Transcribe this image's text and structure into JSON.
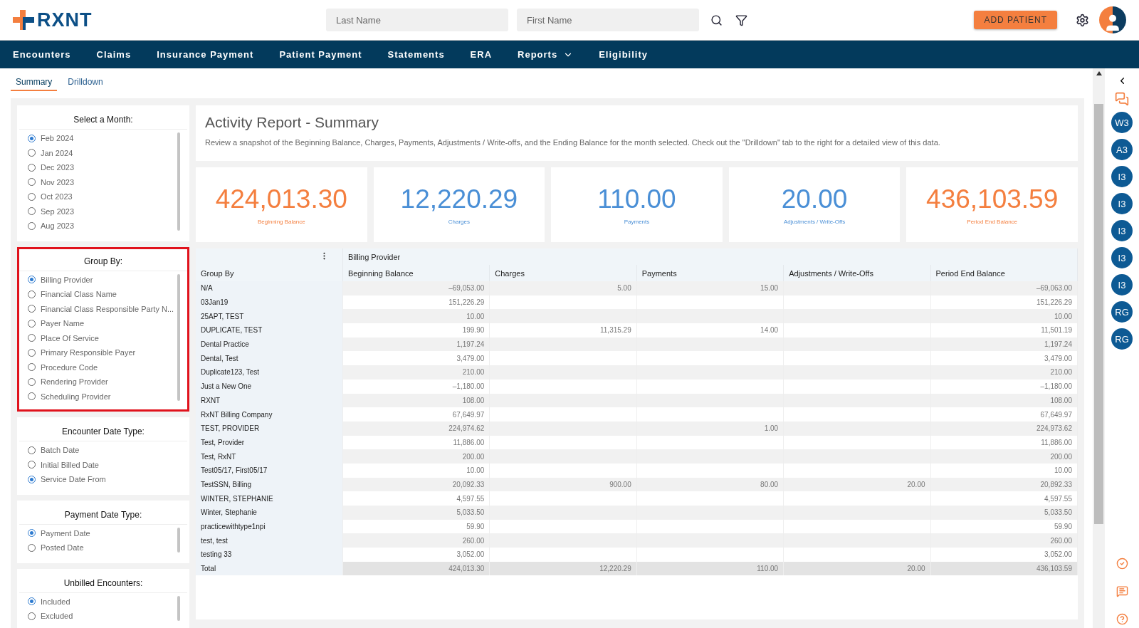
{
  "header": {
    "logo": "RXNT",
    "search_fields": [
      {
        "placeholder": "Last Name"
      },
      {
        "placeholder": "First Name"
      }
    ],
    "add_button": "ADD PATIENT"
  },
  "nav": [
    {
      "label": "Encounters",
      "dropdown": false
    },
    {
      "label": "Claims",
      "dropdown": false
    },
    {
      "label": "Insurance Payment",
      "dropdown": false
    },
    {
      "label": "Patient Payment",
      "dropdown": false
    },
    {
      "label": "Statements",
      "dropdown": false
    },
    {
      "label": "ERA",
      "dropdown": false
    },
    {
      "label": "Reports",
      "dropdown": true
    },
    {
      "label": "Eligibility",
      "dropdown": false
    }
  ],
  "tabs": [
    {
      "label": "Summary",
      "selected": true
    },
    {
      "label": "Drilldown",
      "selected": false
    }
  ],
  "filters": [
    {
      "title": "Select a Month:",
      "highlighted": false,
      "options": [
        {
          "label": "Feb 2024",
          "selected": true
        },
        {
          "label": "Jan 2024",
          "selected": false
        },
        {
          "label": "Dec 2023",
          "selected": false
        },
        {
          "label": "Nov 2023",
          "selected": false
        },
        {
          "label": "Oct 2023",
          "selected": false
        },
        {
          "label": "Sep 2023",
          "selected": false
        },
        {
          "label": "Aug 2023",
          "selected": false
        }
      ]
    },
    {
      "title": "Group By:",
      "highlighted": true,
      "options": [
        {
          "label": "Billing Provider",
          "selected": true
        },
        {
          "label": "Financial Class Name",
          "selected": false
        },
        {
          "label": "Financial Class Responsible Party N...",
          "selected": false
        },
        {
          "label": "Payer Name",
          "selected": false
        },
        {
          "label": "Place Of Service",
          "selected": false
        },
        {
          "label": "Primary Responsible Payer",
          "selected": false
        },
        {
          "label": "Procedure Code",
          "selected": false
        },
        {
          "label": "Rendering Provider",
          "selected": false
        },
        {
          "label": "Scheduling Provider",
          "selected": false
        }
      ]
    },
    {
      "title": "Encounter Date Type:",
      "highlighted": false,
      "options": [
        {
          "label": "Batch Date",
          "selected": false
        },
        {
          "label": "Initial Billed Date",
          "selected": false
        },
        {
          "label": "Service Date From",
          "selected": true
        }
      ]
    },
    {
      "title": "Payment Date Type:",
      "highlighted": false,
      "options": [
        {
          "label": "Payment Date",
          "selected": true
        },
        {
          "label": "Posted Date",
          "selected": false
        }
      ]
    },
    {
      "title": "Unbilled Encounters:",
      "highlighted": false,
      "options": [
        {
          "label": "Included",
          "selected": true
        },
        {
          "label": "Excluded",
          "selected": false
        }
      ]
    }
  ],
  "report": {
    "title": "Activity Report - Summary",
    "description": "Review a snapshot of the Beginning Balance, Charges, Payments, Adjustments / Write-offs, and the Ending Balance for the month selected. Check out the \"Drilldown\" tab to the right for a detailed view of this data."
  },
  "stats": [
    {
      "value": "424,013.30",
      "label": "Beginning Balance",
      "color": "#f47f3f"
    },
    {
      "value": "12,220.29",
      "label": "Charges",
      "color": "#4a8fd6"
    },
    {
      "value": "110.00",
      "label": "Payments",
      "color": "#4a8fd6"
    },
    {
      "value": "20.00",
      "label": "Adjustments / Write-Offs",
      "color": "#4a8fd6"
    },
    {
      "value": "436,103.59",
      "label": "Period End Balance",
      "color": "#f47f3f"
    }
  ],
  "table": {
    "group_header": "Billing Provider",
    "columns": [
      "Group By",
      "Beginning Balance",
      "Charges",
      "Payments",
      "Adjustments / Write-Offs",
      "Period End Balance"
    ],
    "rows": [
      [
        "N/A",
        "–69,053.00",
        "5.00",
        "15.00",
        null,
        "–69,063.00"
      ],
      [
        "03Jan19",
        "151,226.29",
        null,
        null,
        null,
        "151,226.29"
      ],
      [
        "25APT, TEST",
        "10.00",
        null,
        null,
        null,
        "10.00"
      ],
      [
        "DUPLICATE, TEST",
        "199.90",
        "11,315.29",
        "14.00",
        null,
        "11,501.19"
      ],
      [
        "Dental Practice",
        "1,197.24",
        null,
        null,
        null,
        "1,197.24"
      ],
      [
        "Dental, Test",
        "3,479.00",
        null,
        null,
        null,
        "3,479.00"
      ],
      [
        "Duplicate123, Test",
        "210.00",
        null,
        null,
        null,
        "210.00"
      ],
      [
        "Just a New One",
        "–1,180.00",
        null,
        null,
        null,
        "–1,180.00"
      ],
      [
        "RXNT",
        "108.00",
        null,
        null,
        null,
        "108.00"
      ],
      [
        "RxNT Billing Company",
        "67,649.97",
        null,
        null,
        null,
        "67,649.97"
      ],
      [
        "TEST, PROVIDER",
        "224,974.62",
        null,
        "1.00",
        null,
        "224,973.62"
      ],
      [
        "Test, Provider",
        "11,886.00",
        null,
        null,
        null,
        "11,886.00"
      ],
      [
        "Test, RxNT",
        "200.00",
        null,
        null,
        null,
        "200.00"
      ],
      [
        "Test05/17, First05/17",
        "10.00",
        null,
        null,
        null,
        "10.00"
      ],
      [
        "TestSSN, Billing",
        "20,092.33",
        "900.00",
        "80.00",
        "20.00",
        "20,892.33"
      ],
      [
        "WINTER, STEPHANIE",
        "4,597.55",
        null,
        null,
        null,
        "4,597.55"
      ],
      [
        "Winter, Stephanie",
        "5,033.50",
        null,
        null,
        null,
        "5,033.50"
      ],
      [
        "practicewithtype1npi",
        "59.90",
        null,
        null,
        null,
        "59.90"
      ],
      [
        "test, test",
        "260.00",
        null,
        null,
        null,
        "260.00"
      ],
      [
        "testing 33",
        "3,052.00",
        null,
        null,
        null,
        "3,052.00"
      ]
    ],
    "total": [
      "Total",
      "424,013.30",
      "12,220.29",
      "110.00",
      "20.00",
      "436,103.59"
    ]
  },
  "rail": {
    "users": [
      "W3",
      "A3",
      "I3",
      "I3",
      "I3",
      "I3",
      "I3",
      "RG",
      "RG"
    ]
  }
}
